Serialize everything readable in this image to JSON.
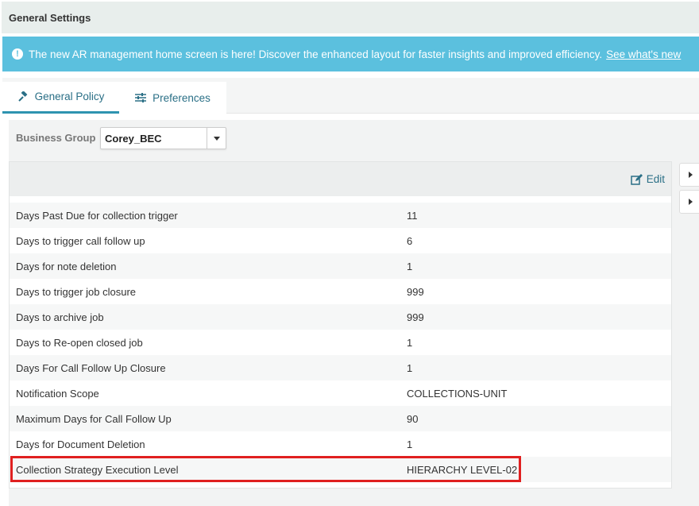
{
  "header": {
    "title": "General Settings"
  },
  "banner": {
    "message": "The new AR management home screen is here! Discover the enhanced layout for faster insights and improved efficiency.",
    "link_label": "See what's new",
    "icon": "info-icon"
  },
  "tabs": [
    {
      "label": "General Policy",
      "icon": "gavel-icon",
      "active": true
    },
    {
      "label": "Preferences",
      "icon": "sliders-icon",
      "active": false
    }
  ],
  "business_group": {
    "label": "Business Group",
    "value": "Corey_BEC"
  },
  "panel": {
    "edit_label": "Edit",
    "rows": [
      {
        "key": "Days Past Due for collection trigger",
        "value": "11"
      },
      {
        "key": "Days to trigger call follow up",
        "value": "6"
      },
      {
        "key": "Days for note deletion",
        "value": "1"
      },
      {
        "key": "Days to trigger job closure",
        "value": "999"
      },
      {
        "key": "Days to archive job",
        "value": "999"
      },
      {
        "key": "Days to Re-open closed job",
        "value": "1"
      },
      {
        "key": "Days For Call Follow Up Closure",
        "value": "1"
      },
      {
        "key": "Notification Scope",
        "value": "COLLECTIONS-UNIT"
      },
      {
        "key": "Maximum Days for Call Follow Up",
        "value": "90"
      },
      {
        "key": "Days for Document Deletion",
        "value": "1"
      },
      {
        "key": "Collection Strategy Execution Level",
        "value": "HIERARCHY LEVEL-02"
      }
    ]
  },
  "colors": {
    "banner": "#5bc0de",
    "accent": "#2a6f86",
    "highlight": "#e02020"
  }
}
